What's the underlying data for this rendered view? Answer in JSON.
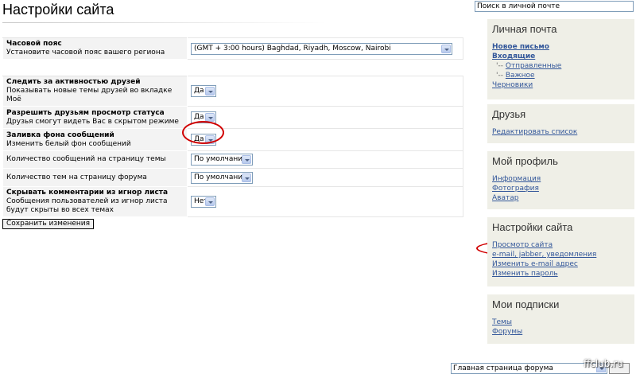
{
  "page": {
    "title": "Настройки сайта"
  },
  "settings": {
    "timezone": {
      "label": "Часовой пояс",
      "desc": "Установите часовой пояс вашего региона",
      "value": "(GMT + 3:00 hours) Baghdad, Riyadh, Moscow, Nairobi"
    },
    "follow_friends": {
      "label": "Следить за активностью друзей",
      "desc": "Показывать новые темы друзей во вкладке Моё",
      "value": "Да"
    },
    "friends_status": {
      "label": "Разрешить друзьям просмотр статуса",
      "desc": "Друзья смогут видеть Вас в скрытом режиме",
      "value": "Да"
    },
    "message_bg": {
      "label": "Заливка фона сообщений",
      "desc": "Изменить белый фон сообщений",
      "value": "Да"
    },
    "posts_per_topic": {
      "label": "Количество сообщений на страницу темы",
      "value": "По умолчанию"
    },
    "topics_per_forum": {
      "label": "Количество тем на страницу форума",
      "value": "По умолчанию"
    },
    "hide_ignored": {
      "label": "Скрывать комментарии из игнор листа",
      "desc": "Сообщения пользователей из игнор листа будут скрыты во всех темах",
      "value": "Нет"
    },
    "save_label": "Сохранить изменения"
  },
  "sidebar": {
    "search_value": "Поиск в личной почте",
    "mail": {
      "title": "Личная почта",
      "new_letter": "Новое письмо",
      "inbox": "Входящие",
      "sent_prefix": "'--",
      "sent": "Отправленные",
      "important_prefix": "'--",
      "important": "Важное",
      "drafts": "Черновики"
    },
    "friends": {
      "title": "Друзья",
      "edit_list": "Редактировать список"
    },
    "profile": {
      "title": "Мой профиль",
      "info": "Информация",
      "photo": "Фотография",
      "avatar": "Аватар"
    },
    "site_settings": {
      "title": "Настройки сайта",
      "view_site": "Просмотр сайта",
      "email_jabber": "e-mail, jabber, уведомления",
      "change_email": "Изменить e-mail адрес",
      "change_password": "Изменить пароль"
    },
    "subscriptions": {
      "title": "Мои подписки",
      "topics": "Темы",
      "forums": "Форумы"
    }
  },
  "footer": {
    "forum_select_value": "Главная страница форума",
    "watermark": "ffclub.ru"
  },
  "colors": {
    "link": "#33579a",
    "highlight": "#d10000",
    "sidebar_bg": "#efefe7",
    "row_bg": "#f3f3f3"
  }
}
